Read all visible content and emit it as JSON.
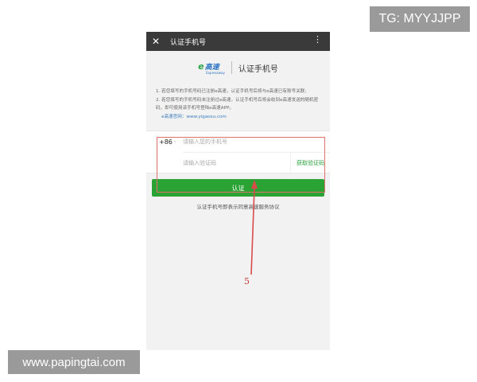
{
  "watermarks": {
    "top_right": "TG: MYYJJPP",
    "bottom_left": "www.papingtai.com"
  },
  "titlebar": {
    "close_icon": "close-icon",
    "title": "认证手机号",
    "more_icon": "more-vertical-icon",
    "close_glyph": "✕",
    "more_glyph": "⋮"
  },
  "brand": {
    "logo_letter": "e",
    "logo_text": "高速",
    "logo_sub": "Expressway",
    "heading": "认证手机号"
  },
  "notes": {
    "item1": "1. 若您填写的手机号码已注册e高速，认证手机号后将与e高速已有账号关联;",
    "item2": "2. 若您填写的手机号码未注册过e高速，认证手机号后将会收到e高速发送的随机密码，即可使用该手机号登陆e高速APP。",
    "link": "e高速官网：www.yigaosu.com"
  },
  "form": {
    "country_code": "+86",
    "arrow": "›",
    "phone_placeholder": "请输入您的手机号",
    "code_placeholder": "请输入验证码",
    "get_code_label": "获取验证码"
  },
  "submit_label": "认证",
  "agreement_text": "认证手机号即表示同意高速服务协议",
  "annotation": {
    "step_number": "5",
    "color": "#d94a4a"
  },
  "colors": {
    "primary_green": "#2aa334",
    "titlebar_bg": "#3a3a3a",
    "link_blue": "#3a7cc0"
  }
}
